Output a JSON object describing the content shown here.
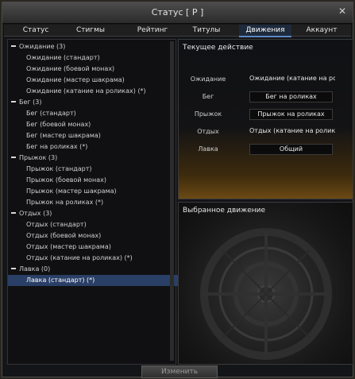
{
  "window": {
    "title": "Статус [ P ]",
    "close_glyph": "✕"
  },
  "tabs": [
    {
      "label": "Статус",
      "active": false
    },
    {
      "label": "Стигмы",
      "active": false
    },
    {
      "label": "Рейтинг",
      "active": false
    },
    {
      "label": "Титулы",
      "active": false
    },
    {
      "label": "Движения",
      "active": true
    },
    {
      "label": "Аккаунт",
      "active": false
    }
  ],
  "tree": {
    "categories": [
      {
        "label": "Ожидание (3)",
        "items": [
          "Ожидание (стандарт)",
          "Ожидание (боевой монах)",
          "Ожидание (мастер шакрама)",
          "Ожидание (катание на роликах) (*)"
        ]
      },
      {
        "label": "Бег (3)",
        "items": [
          "Бег (стандарт)",
          "Бег (боевой монах)",
          "Бег (мастер шакрама)",
          "Бег на роликах (*)"
        ]
      },
      {
        "label": "Прыжок (3)",
        "items": [
          "Прыжок (стандарт)",
          "Прыжок (боевой монах)",
          "Прыжок (мастер шакрама)",
          "Прыжок на роликах (*)"
        ]
      },
      {
        "label": "Отдых (3)",
        "items": [
          "Отдых (стандарт)",
          "Отдых (боевой монах)",
          "Отдых (мастер шакрама)",
          "Отдых (катание на роликах) (*)"
        ]
      },
      {
        "label": "Лавка (0)",
        "items": [
          "Лавка (стандарт) (*)"
        ]
      }
    ],
    "selected_item": "Лавка (стандарт) (*)"
  },
  "current_action": {
    "title": "Текущее действие",
    "rows": [
      {
        "label": "Ожидание",
        "value": "Ожидание (катание на ролі"
      },
      {
        "label": "Бег",
        "value": "Бег на роликах"
      },
      {
        "label": "Прыжок",
        "value": "Прыжок на роликах"
      },
      {
        "label": "Отдых",
        "value": "Отдых (катание на роликах"
      },
      {
        "label": "Лавка",
        "value": "Общий"
      }
    ]
  },
  "selected_motion": {
    "title": "Выбранное движение"
  },
  "footer": {
    "change_label": "Изменить"
  },
  "colors": {
    "accent": "#5b88c4",
    "selected_row": "#2a3f66",
    "gold": "#6b4914"
  }
}
